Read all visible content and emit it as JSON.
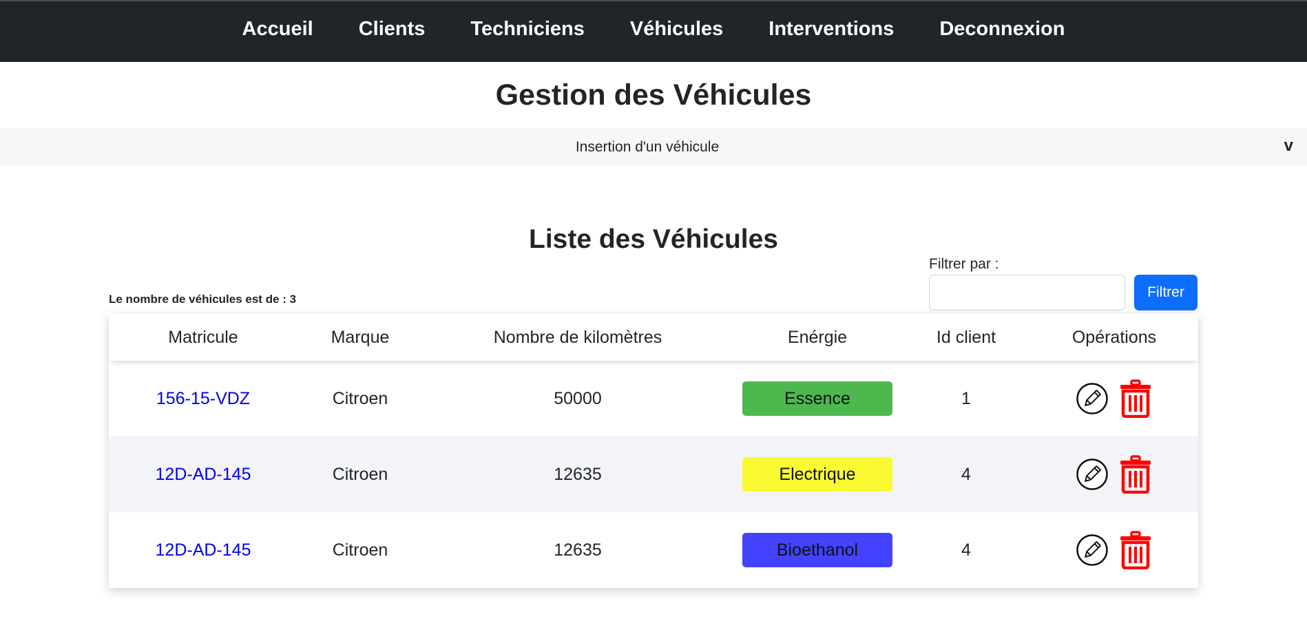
{
  "nav": {
    "items": [
      {
        "label": "Accueil"
      },
      {
        "label": "Clients"
      },
      {
        "label": "Techniciens"
      },
      {
        "label": "Véhicules"
      },
      {
        "label": "Interventions"
      },
      {
        "label": "Deconnexion"
      }
    ]
  },
  "page": {
    "title": "Gestion des Véhicules",
    "accordion_label": "Insertion d'un véhicule",
    "accordion_chevron": "v"
  },
  "list": {
    "title": "Liste des Véhicules",
    "count_text": "Le nombre de véhicules est de : 3",
    "filter_label": "Filtrer par :",
    "filter_value": "",
    "filter_button": "Filtrer"
  },
  "table": {
    "headers": [
      "Matricule",
      "Marque",
      "Nombre de kilomètres",
      "Enérgie",
      "Id client",
      "Opérations"
    ],
    "rows": [
      {
        "matricule": "156-15-VDZ",
        "marque": "Citroen",
        "km": "50000",
        "energie": "Essence",
        "energie_color": "#4cb84e",
        "id_client": "1"
      },
      {
        "matricule": "12D-AD-145",
        "marque": "Citroen",
        "km": "12635",
        "energie": "Electrique",
        "energie_color": "#fafa32",
        "id_client": "4"
      },
      {
        "matricule": "12D-AD-145",
        "marque": "Citroen",
        "km": "12635",
        "energie": "Bioethanol",
        "energie_color": "#4242ff",
        "id_client": "4"
      }
    ]
  },
  "icons": {
    "edit": "pencil-circle-icon",
    "delete": "trash-icon"
  },
  "colors": {
    "navbar": "#212529",
    "filter_button": "#0d6efd",
    "link": "#0000ee",
    "delete": "#ff0000"
  }
}
